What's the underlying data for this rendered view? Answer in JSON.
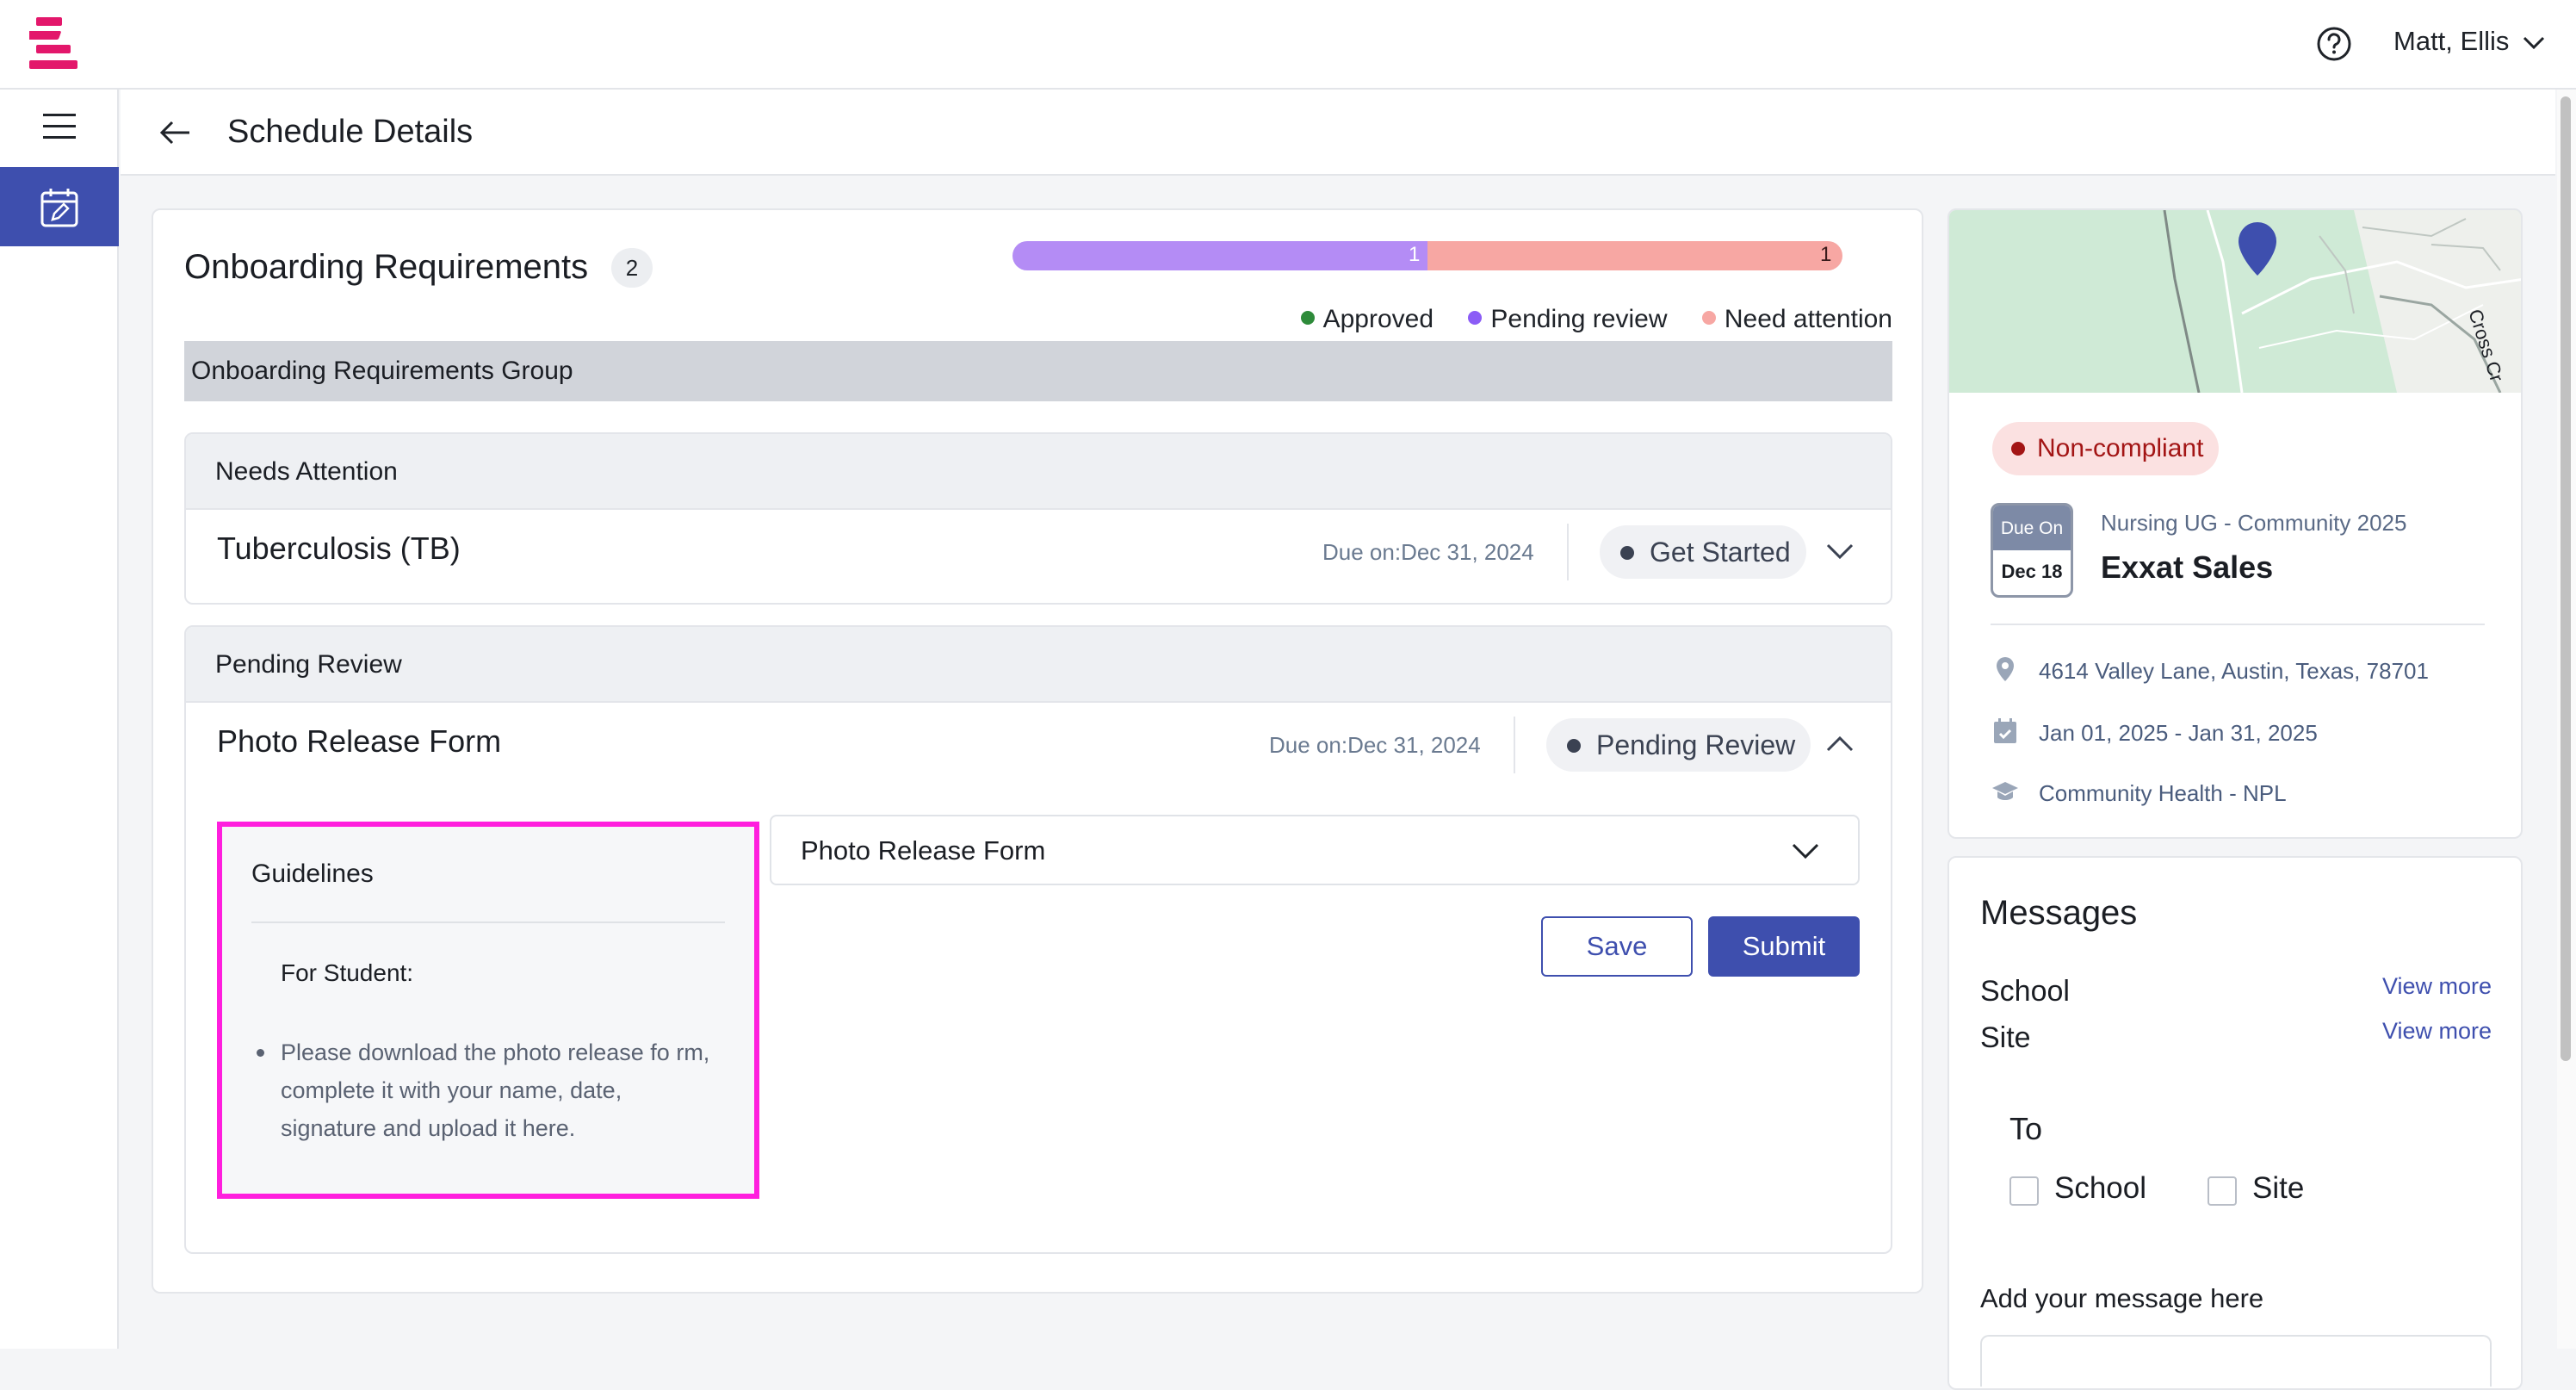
{
  "header": {
    "user_name": "Matt, Ellis"
  },
  "page": {
    "title": "Schedule Details"
  },
  "onboarding": {
    "title": "Onboarding Requirements",
    "count": "2",
    "progress": {
      "pending": {
        "value": 1,
        "label": "1",
        "color": "#b48cf5"
      },
      "attention": {
        "value": 1,
        "label": "1",
        "color": "#f7a7a3"
      }
    },
    "legend": [
      {
        "label": "Approved",
        "color": "#2e8b3a"
      },
      {
        "label": "Pending review",
        "color": "#8b5cf6"
      },
      {
        "label": "Need attention",
        "color": "#f7a7a3"
      }
    ],
    "group_title": "Onboarding Requirements Group",
    "needs_attention": {
      "heading": "Needs Attention",
      "item": {
        "name": "Tuberculosis (TB)",
        "due": "Due on:Dec 31, 2024",
        "status": "Get Started"
      }
    },
    "pending_review": {
      "heading": "Pending Review",
      "item": {
        "name": "Photo Release Form",
        "due": "Due on:Dec 31, 2024",
        "status": "Pending Review"
      }
    },
    "guidelines": {
      "title": "Guidelines",
      "subtitle": "For Student:",
      "bullets": [
        "Please download the photo release fo rm, complete it with your name, date, signature and upload it here."
      ]
    },
    "form_select": {
      "label": "Photo Release Form"
    },
    "buttons": {
      "save": "Save",
      "submit": "Submit"
    }
  },
  "info": {
    "status": "Non-compliant",
    "due_tile": {
      "top": "Due On",
      "bottom": "Dec 18"
    },
    "program": "Nursing UG - Community 2025",
    "site": "Exxat Sales",
    "address": "4614 Valley Lane, Austin, Texas, 78701",
    "dates": "Jan 01, 2025 - Jan 31, 2025",
    "discipline": "Community Health - NPL",
    "map_road_label": "Cross Cr"
  },
  "messages": {
    "title": "Messages",
    "rows": [
      {
        "label": "School",
        "link": "View more"
      },
      {
        "label": "Site",
        "link": "View more"
      }
    ],
    "to_label": "To",
    "recipients": [
      "School",
      "Site"
    ],
    "add_label": "Add your message here"
  },
  "colors": {
    "primary": "#3e4fae",
    "brand": "#e3176b",
    "highlight": "#ff1fde"
  }
}
